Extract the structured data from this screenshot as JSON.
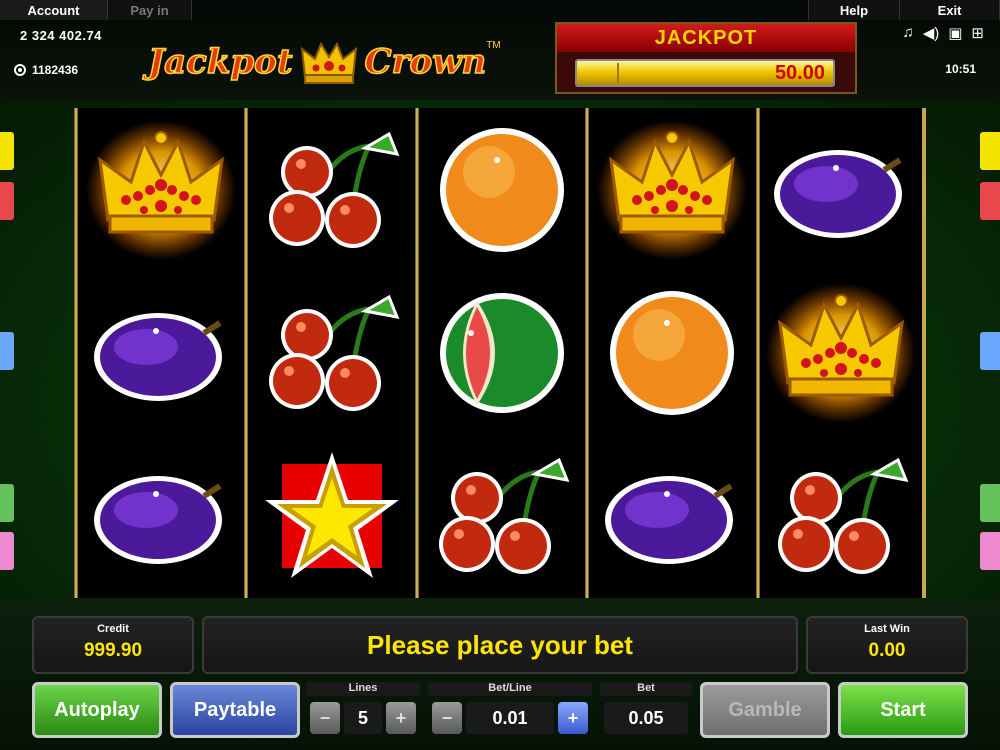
{
  "tabs": {
    "account": "Account",
    "payin": "Pay in",
    "help": "Help",
    "exit": "Exit"
  },
  "balance": "2 324 402.74",
  "coins": "1182436",
  "logo": {
    "word1": "Jackpot",
    "word2": "Crown",
    "tm": "TM"
  },
  "jackpot": {
    "title": "JACKPOT",
    "value": "50.00",
    "level": 1.0
  },
  "status_icons": [
    "music-note-icon",
    "sound-icon",
    "settings-icon",
    "fullscreen-icon"
  ],
  "clock": "10:51",
  "reels": [
    [
      "crown",
      "plum",
      "plum"
    ],
    [
      "cherries",
      "cherries",
      "star"
    ],
    [
      "orange",
      "watermelon",
      "cherries"
    ],
    [
      "crown",
      "orange",
      "plum"
    ],
    [
      "plum",
      "crown",
      "cherries"
    ]
  ],
  "side_markers": {
    "left": [
      "#f5e400",
      "#e8484b",
      "#6aa8ff",
      "#63c35a",
      "#f08ad0"
    ],
    "right": [
      "#f5e400",
      "#e8484b",
      "#6aa8ff",
      "#63c35a",
      "#f08ad0"
    ]
  },
  "credit": {
    "label": "Credit",
    "value": "999.90"
  },
  "message": "Please place your bet",
  "last_win": {
    "label": "Last Win",
    "value": "0.00"
  },
  "buttons": {
    "autoplay": "Autoplay",
    "paytable": "Paytable",
    "gamble": "Gamble",
    "start": "Start"
  },
  "controls": {
    "lines_label": "Lines",
    "lines_value": "5",
    "betline_label": "Bet/Line",
    "betline_value": "0.01",
    "bet_label": "Bet",
    "bet_value": "0.05",
    "minus": "−",
    "plus": "+"
  }
}
